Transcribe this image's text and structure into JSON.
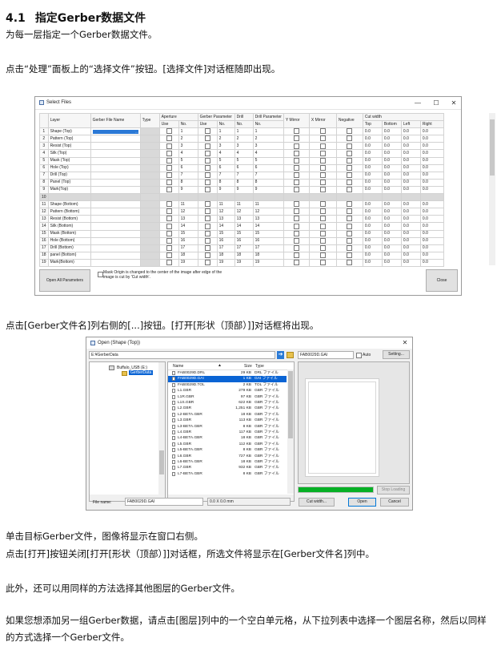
{
  "heading": {
    "number": "4.1",
    "title": "指定Gerber数据文件"
  },
  "paragraphs": {
    "p1": "为每一层指定一个Gerber数据文件。",
    "p2": "点击“处理”面板上的“选择文件”按钮。[选择文件]对话框随即出现。",
    "p3": "点击[Gerber文件名]列右侧的[...]按钮。[打开[形状（顶部）]]对话框将出现。",
    "p4": "单击目标Gerber文件，图像将显示在窗口右侧。",
    "p5": "点击[打开]按钮关闭[打开[形状（顶部）]]对话框，所选文件将显示在[Gerber文件名]列中。",
    "p6": "此外，还可以用同样的方法选择其他图层的Gerber文件。",
    "p7": "如果您想添加另一组Gerber数据，请点击[图层]列中的一个空白单元格，从下拉列表中选择一个图层名称，然后以同样的方式选择一个Gerber文件。"
  },
  "select_files": {
    "title": "Select Files",
    "window_controls": {
      "minimize": "—",
      "maximize": "☐",
      "close": "✕"
    },
    "headers": {
      "layer": "Layer",
      "gerber_file_name": "Gerber File Name",
      "type": "Type",
      "aperture": "Aperture",
      "gerber_parameter": "Gerber Parameter",
      "drill": "Drill",
      "drill_parameter": "Drill Parameter",
      "y_mirror": "Y Mirror",
      "x_mirror": "X Mirror",
      "negative": "Negative",
      "cut_width": "Cut width",
      "use": "Use",
      "no": "No.",
      "top": "Top",
      "bottom": "Bottom",
      "left": "Left",
      "right": "Right"
    },
    "rows": [
      {
        "n": "1",
        "layer": "Shape (Top)",
        "num": "1",
        "selected": true
      },
      {
        "n": "2",
        "layer": "Pattern (Top)",
        "num": "2"
      },
      {
        "n": "3",
        "layer": "Resist (Top)",
        "num": "3"
      },
      {
        "n": "4",
        "layer": "Silk (Top)",
        "num": "4"
      },
      {
        "n": "5",
        "layer": "Mask (Top)",
        "num": "5"
      },
      {
        "n": "6",
        "layer": "Hole (Top)",
        "num": "6"
      },
      {
        "n": "7",
        "layer": "Drill (Top)",
        "num": "7"
      },
      {
        "n": "8",
        "layer": "Panel (Top)",
        "num": "8"
      },
      {
        "n": "9",
        "layer": "Mark(Top)",
        "num": "9"
      },
      {
        "n": "10",
        "layer": "",
        "num": "",
        "blank": true
      },
      {
        "n": "11",
        "layer": "Shape (Bottom)",
        "num": "11"
      },
      {
        "n": "12",
        "layer": "Pattern (Bottom)",
        "num": "12"
      },
      {
        "n": "13",
        "layer": "Resist (Bottom)",
        "num": "13"
      },
      {
        "n": "14",
        "layer": "Silk (Bottom)",
        "num": "14"
      },
      {
        "n": "15",
        "layer": "Mask (Bottom)",
        "num": "15"
      },
      {
        "n": "16",
        "layer": "Hole (Bottom)",
        "num": "16"
      },
      {
        "n": "17",
        "layer": "Drill (Bottom)",
        "num": "17"
      },
      {
        "n": "18",
        "layer": "panel (Bottom)",
        "num": "18"
      },
      {
        "n": "19",
        "layer": "Mark(Bottom)",
        "num": "19"
      }
    ],
    "cut_value": "0.0",
    "open_all_button": "Open All Parameters",
    "mask_origin_note": "Mask Origin is changed to the center of the image after edge of the image is cut by 'Cut width'.",
    "close_button": "Close"
  },
  "open_dialog": {
    "title": "Open (Shape (Top))",
    "path": "E:¥GerberData",
    "selected_name": "FAB0029D.GAI",
    "auto_label": "Auto",
    "setting_button": "Setting...",
    "tree": {
      "drive": "Buffalo_USB (E:)",
      "folder": "GerberData"
    },
    "columns": {
      "name": "Name",
      "size": "Size",
      "type": "Type"
    },
    "files": [
      {
        "name": "FAB0029D.DRL",
        "size": "29 KB",
        "type": "DRL ファイル"
      },
      {
        "name": "FAB0029D.GAI",
        "size": "1 KB",
        "type": "GAI ファイル",
        "selected": true
      },
      {
        "name": "FAB0029D.TOL",
        "size": "2 KB",
        "type": "TOL ファイル"
      },
      {
        "name": "L1.GBR",
        "size": "279 KB",
        "type": "GBR ファイル"
      },
      {
        "name": "L1R.GBR",
        "size": "97 KB",
        "type": "GBR ファイル"
      },
      {
        "name": "L1S.GBR",
        "size": "622 KB",
        "type": "GBR ファイル"
      },
      {
        "name": "L2.GBR",
        "size": "1,251 KB",
        "type": "GBR ファイル"
      },
      {
        "name": "L2-BETA.GBR",
        "size": "18 KB",
        "type": "GBR ファイル"
      },
      {
        "name": "L3.GBR",
        "size": "113 KB",
        "type": "GBR ファイル"
      },
      {
        "name": "L3-BETA.GBR",
        "size": "8 KB",
        "type": "GBR ファイル"
      },
      {
        "name": "L4.GBR",
        "size": "117 KB",
        "type": "GBR ファイル"
      },
      {
        "name": "L4-BETA.GBR",
        "size": "18 KB",
        "type": "GBR ファイル"
      },
      {
        "name": "L5.GBR",
        "size": "112 KB",
        "type": "GBR ファイル"
      },
      {
        "name": "L5-BETA.GBR",
        "size": "8 KB",
        "type": "GBR ファイル"
      },
      {
        "name": "L6.GBR",
        "size": "727 KB",
        "type": "GBR ファイル"
      },
      {
        "name": "L6-BETA.GBR",
        "size": "18 KB",
        "type": "GBR ファイル"
      },
      {
        "name": "L7.GBR",
        "size": "932 KB",
        "type": "GBR ファイル"
      },
      {
        "name": "L7-BETA.GBR",
        "size": "8 KB",
        "type": "GBR ファイル"
      }
    ],
    "stop_loading_button": "Stop Loading",
    "file_name_label": "File name:",
    "file_name_value": "FAB0029D.GAI",
    "dimension": "0.0 X 0.0 mm",
    "cut_width_button": "Cut width...",
    "open_button": "Open",
    "cancel_button": "Cancel",
    "progress": 1.0
  },
  "colors": {
    "selection": "#0a64d4",
    "progress": "#06b025"
  }
}
